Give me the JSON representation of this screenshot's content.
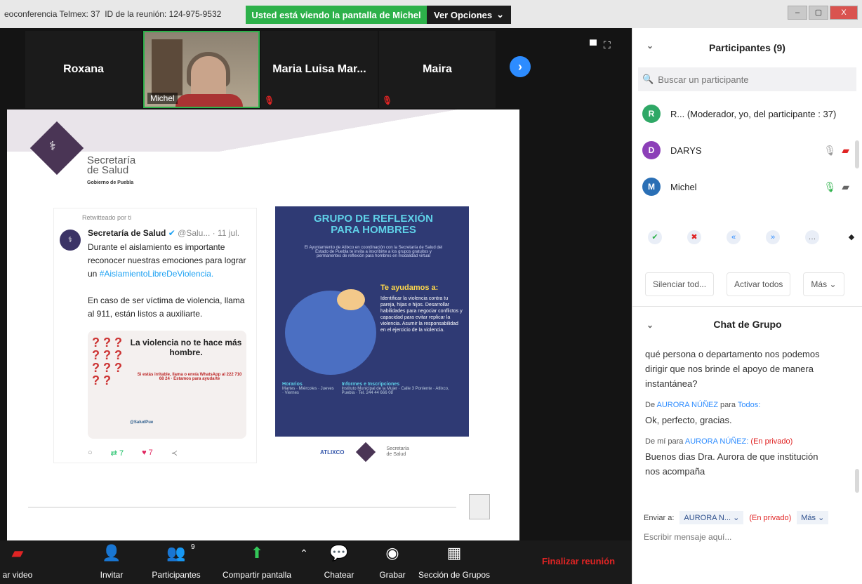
{
  "titlebar": {
    "meeting": "eoconferencia Telmex: 37",
    "id_label": "ID de la reunión: 124-975-9532"
  },
  "banner": {
    "text": "Usted está viendo la pantalla de Michel",
    "options": "Ver Opciones"
  },
  "strip": {
    "tiles": [
      {
        "name": "Roxana"
      },
      {
        "name": "Michel"
      },
      {
        "name": "Maria Luisa Mar..."
      },
      {
        "name": "Maira"
      }
    ]
  },
  "slide": {
    "org": {
      "line1": "Secretaría",
      "line2": "de Salud",
      "line3": "Gobierno de Puebla"
    },
    "tweet": {
      "retweet": "Retwitteado por ti",
      "author": "Secretaría de Salud",
      "handle": "@Salu... · 11 jul.",
      "text1": "Durante el aislamiento es importante reconocer nuestras emociones para lograr un",
      "hashtag": "#AislamientoLibreDeViolencia.",
      "text2": "En caso de ser víctima de violencia, llama al 911, están listos a auxiliarte.",
      "card_title": "La violencia no te hace más hombre.",
      "card_sub": "Si estás irritable, llama o envía WhatsApp al 222 710 68 24 · Estamos para ayudarte",
      "card_handle": "@SaludPue",
      "retweets": "7",
      "likes": "7"
    },
    "poster": {
      "title": "GRUPO DE REFLEXIÓN PARA HOMBRES",
      "intro": "El Ayuntamiento de Atlixco en coordinación con la Secretaría de Salud del Estado de Puebla te invita a inscribirte a los grupos gratuitos y permanentes de reflexión para hombres en modalidad virtual",
      "help_title": "Te ayudamos a:",
      "help_items": "Identificar la violencia contra tu pareja, hijas e hijos. Desarrollar habilidades para negociar conflictos y capacidad para evitar replicar la violencia. Asumir la responsabilidad en el ejercicio de la violencia.",
      "hours_title": "Horarios",
      "hours": "Martes · Miércoles · Jueves · Viernes",
      "info_title": "Informes e Inscripciones",
      "info": "Instituto Municipal de la Mujer · Calle 3 Poniente · Atlixco, Puebla · Tel. 244 44 666 08"
    },
    "logos": {
      "left": "ATLIXCO",
      "right_line1": "Secretaría",
      "right_line2": "de Salud"
    }
  },
  "toolbar": {
    "video": "ar video",
    "invite": "Invitar",
    "participants": "Participantes",
    "participants_count": "9",
    "share": "Compartir pantalla",
    "chat": "Chatear",
    "record": "Grabar",
    "breakout": "Sección de Grupos",
    "end": "Finalizar reunión"
  },
  "panel": {
    "participants_title": "Participantes (9)",
    "search_placeholder": "Buscar un participante",
    "participants": [
      {
        "initial": "R",
        "name": "R... (Moderador, yo, del participante : 37)",
        "color": "#2fa866"
      },
      {
        "initial": "D",
        "name": "DARYS",
        "color": "#8c3fb8"
      },
      {
        "initial": "M",
        "name": "Michel",
        "color": "#2a6fb5"
      }
    ],
    "mute_all": "Silenciar tod...",
    "unmute_all": "Activar todos",
    "more": "Más",
    "chat_title": "Chat de Grupo",
    "messages": [
      {
        "text": "qué persona o departamento nos podemos dirigir que nos brinde el apoyo de manera instantánea?"
      },
      {
        "from": "De",
        "sender": "AURORA NÚÑEZ",
        "to_word": "para",
        "to": "Todos:",
        "text": "Ok, perfecto, gracias."
      },
      {
        "from": "De mí para",
        "recipient": "AURORA NÚÑEZ:",
        "priv": "(En privado)",
        "text": "Buenos dias Dra. Aurora de que institución nos acompaña"
      }
    ],
    "send_to_label": "Enviar a:",
    "send_to_value": "AURORA N...",
    "send_priv": "(En privado)",
    "send_more": "Más",
    "message_placeholder": "Escribir mensaje aquí..."
  }
}
